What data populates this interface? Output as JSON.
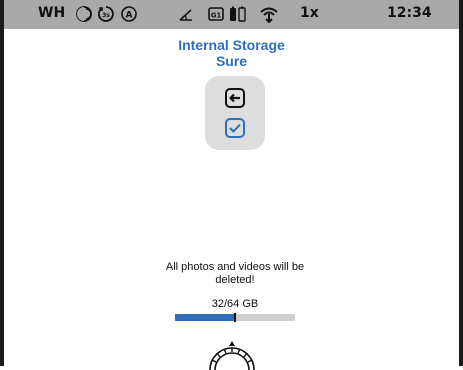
{
  "status_bar": {
    "left_label": "WH",
    "icons": [
      "moon-icon",
      "timer-icon",
      "auto-icon",
      "angle-icon",
      "g1-icon",
      "battery-icon",
      "wifi-icon"
    ],
    "g1_label": "G1",
    "speed": "1x",
    "time": "12:34"
  },
  "dialog": {
    "title_line1": "Internal Storage",
    "title_line2": "Sure",
    "warning_line1": "All photos and videos will be",
    "warning_line2": "deleted!",
    "capacity": "32/64 GB",
    "used_fraction": 0.5
  },
  "colors": {
    "accent": "#2f6fba",
    "status_bar_bg": "#a9a9a9",
    "panel_bg": "#dddddd",
    "bar_track": "#cfcfcf"
  }
}
